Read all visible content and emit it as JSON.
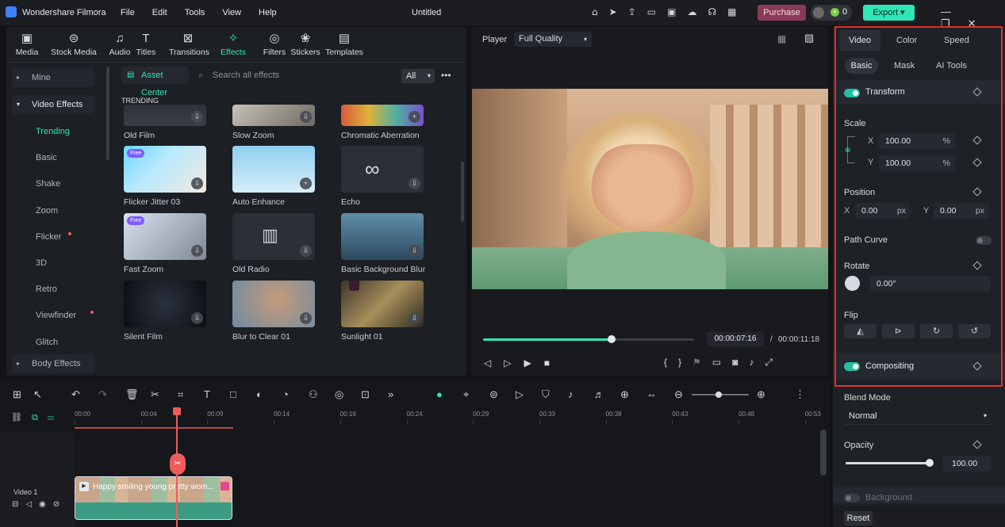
{
  "app": {
    "name": "Wondershare Filmora",
    "project": "Untitled",
    "purchase": "Purchase",
    "credits": "0",
    "export": "Export"
  },
  "menu": [
    "File",
    "Edit",
    "Tools",
    "View",
    "Help"
  ],
  "library_tabs": [
    "Media",
    "Stock Media",
    "Audio",
    "Titles",
    "Transitions",
    "Effects",
    "Filters",
    "Stickers",
    "Templates"
  ],
  "library_tab_icons": [
    "media-icon",
    "stock-media-icon",
    "audio-icon",
    "titles-icon",
    "transitions-icon",
    "effects-icon",
    "filters-icon",
    "stickers-icon",
    "templates-icon"
  ],
  "effects_sidebar": {
    "mine": "Mine",
    "video_effects": "Video Effects",
    "items": [
      "Trending",
      "Basic",
      "Shake",
      "Zoom",
      "Flicker",
      "3D",
      "Retro",
      "Viewfinder",
      "Glitch"
    ],
    "body_effects": "Body Effects"
  },
  "effects_toolbar": {
    "asset_center": "Asset Center",
    "search_placeholder": "Search all effects",
    "filter": "All"
  },
  "section_label": "TRENDING",
  "effects": [
    {
      "name": "Old Film",
      "badge": ""
    },
    {
      "name": "Slow Zoom",
      "badge": ""
    },
    {
      "name": "Chromatic Aberration",
      "badge": ""
    },
    {
      "name": "Flicker Jitter 03",
      "badge": "Free"
    },
    {
      "name": "Auto Enhance",
      "badge": ""
    },
    {
      "name": "Echo",
      "badge": ""
    },
    {
      "name": "Fast Zoom",
      "badge": "Free"
    },
    {
      "name": "Old Radio",
      "badge": ""
    },
    {
      "name": "Basic Background Blur",
      "badge": ""
    },
    {
      "name": "Silent Film",
      "badge": ""
    },
    {
      "name": "Blur to Clear 01",
      "badge": ""
    },
    {
      "name": "Sunlight 01",
      "badge": ""
    }
  ],
  "player": {
    "label": "Player",
    "quality": "Full Quality",
    "current_time": "00:00:07:16",
    "total_time": "00:00:11:18",
    "progress": 0.61
  },
  "properties": {
    "tabs": [
      "Video",
      "Color",
      "Speed"
    ],
    "subtabs": [
      "Basic",
      "Mask",
      "AI Tools"
    ],
    "transform": "Transform",
    "scale": "Scale",
    "scale_x": "100.00",
    "scale_y": "100.00",
    "unit_pct": "%",
    "position": "Position",
    "pos_x": "0.00",
    "pos_y": "0.00",
    "unit_px": "px",
    "path_curve": "Path Curve",
    "rotate": "Rotate",
    "rotate_value": "0.00°",
    "flip": "Flip",
    "compositing": "Compositing",
    "blend_mode": "Blend Mode",
    "blend_value": "Normal",
    "opacity": "Opacity",
    "opacity_value": "100.00",
    "background": "Background",
    "reset": "Reset",
    "highlight_color": "#e0302f"
  },
  "timeline": {
    "ruler": [
      "00:00",
      "00:04",
      "00:09",
      "00:14",
      "00:19",
      "00:24",
      "00:29",
      "00:33",
      "00:38",
      "00:43",
      "00:48",
      "00:53"
    ],
    "track_name": "Video 1",
    "clip_title": "Happy smiling young pretty wom...",
    "accent": "#24c1a0",
    "playhead_color": "#ef5b5b"
  }
}
